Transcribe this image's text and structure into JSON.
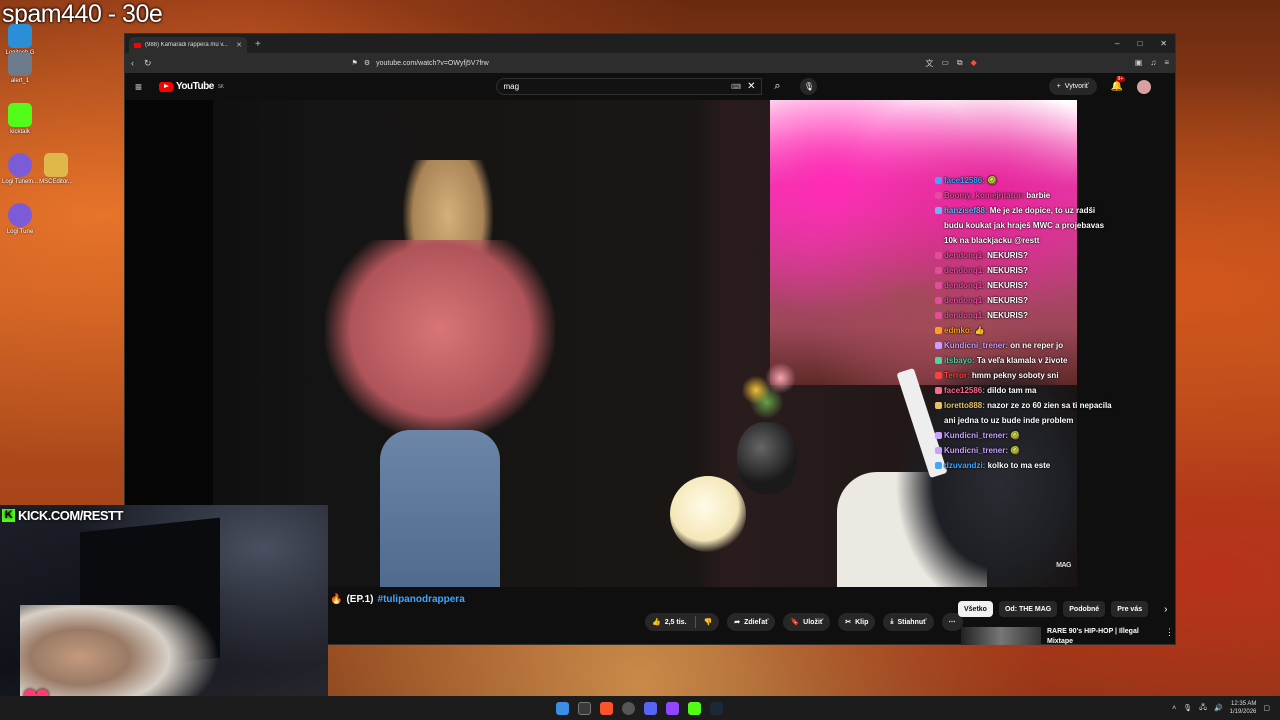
{
  "stream_overlay": {
    "title": "spam440 - 30e",
    "kick_banner": "KICK.COM/RESTT"
  },
  "desktop_icons": [
    {
      "label": "Logitech G HUB",
      "color": "#2a8fd6"
    },
    {
      "label": "alert_1",
      "color": "#6c7a8c"
    },
    {
      "label": "kicktalk",
      "color": "#53fc18"
    },
    {
      "label": "Logi Tuneln...",
      "color": "#7b5cd6"
    },
    {
      "label": "MSCEditor...",
      "color": "#e0b84a"
    },
    {
      "label": "Logi Tune",
      "color": "#7b5cd6"
    }
  ],
  "browser": {
    "tab_title": "(988) Kamarádi rappera mu v...",
    "url": "youtube.com/watch?v=OWyfj5V7frw",
    "window_controls": [
      "–",
      "□",
      "✕"
    ]
  },
  "youtube": {
    "logo": "YouTube",
    "logo_region": "SK",
    "search_value": "mag",
    "create_label": "Vytvoriť",
    "notif_count": "9+",
    "video_watermark": "MAG",
    "title_prefix": "(EP.1)",
    "title_hashtag": "#tulipanodrappera",
    "likes": "2,5 tis.",
    "share_label": "Zdieľať",
    "save_label": "Uložiť",
    "clip_label": "Klip",
    "download_label": "Stiahnuť",
    "chips": [
      "Všetko",
      "Od: THE MAG",
      "Podobné",
      "Pre vás"
    ],
    "rec_title": "RARE 90's HIP-HOP | Illegal Mixtape"
  },
  "chat": [
    {
      "user": "face12586",
      "color": "#3ea6ff",
      "msg": "🥝"
    },
    {
      "user": "Boomy_komejntator",
      "color": "#e34b9b",
      "msg": "barbie"
    },
    {
      "user": "hanzisef88",
      "color": "#6ab4ff",
      "msg": "Me je zle dopice, to uz radši budu koukat jak hraješ MWC a projebavas 10k na blackjacku @restt"
    },
    {
      "user": "dendonq1",
      "color": "#e34b9b",
      "msg": "NEKURIS?"
    },
    {
      "user": "dendonq1",
      "color": "#e34b9b",
      "msg": "NEKURIS?"
    },
    {
      "user": "dendonq1",
      "color": "#e34b9b",
      "msg": "NEKURIS?"
    },
    {
      "user": "dendonq1",
      "color": "#e34b9b",
      "msg": "NEKURIS?"
    },
    {
      "user": "dendonq1",
      "color": "#e34b9b",
      "msg": "NEKURIS?"
    },
    {
      "user": "edmko",
      "color": "#ff9f1c",
      "msg": "👍"
    },
    {
      "user": "Kundicni_trener",
      "color": "#c9a0ff",
      "msg": "on ne reper jo"
    },
    {
      "user": "itsbayo",
      "color": "#4bd6a6",
      "msg": "Ta veľa klamala v živote"
    },
    {
      "user": "Terror",
      "color": "#ff4040",
      "msg": "hmm pekny soboty sni"
    },
    {
      "user": "face12586",
      "color": "#ff6a8a",
      "msg": "dildo tam ma"
    },
    {
      "user": "loretto888",
      "color": "#e8c06a",
      "msg": "nazor ze zo 60 zien sa ti nepacila ani jedna to uz bude inde problem"
    },
    {
      "user": "Kundicni_trener",
      "color": "#c9a0ff",
      "msg": "🥝"
    },
    {
      "user": "Kundicni_trener",
      "color": "#c9a0ff",
      "msg": "🥝"
    },
    {
      "user": "dzuvandzi",
      "color": "#3ea6ff",
      "msg": "kolko to ma este"
    }
  ],
  "taskbar": {
    "time": "12:35 AM",
    "date": "1/19/2026"
  }
}
